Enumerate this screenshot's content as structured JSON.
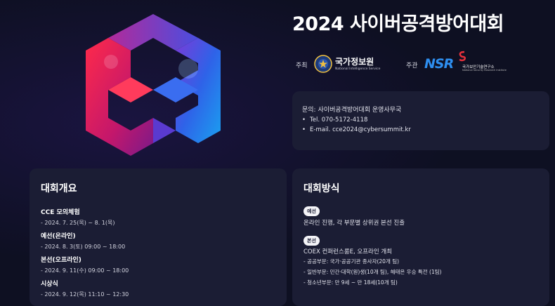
{
  "hero": {
    "title": "2024 사이버공격방어대회",
    "host_label": "주최",
    "host_name": "국가정보원",
    "host_en": "National Intelligence Service",
    "organizer_label": "주관",
    "organizer_logo": "NSR",
    "organizer_name": "국가보안기술연구소",
    "organizer_en": "National Security Research Institute"
  },
  "contact": {
    "title": "문의: 사이버공격방어대회 운영사무국",
    "tel": "Tel. 070-5172-4118",
    "email": "E-mail. cce2024@cybersummit.kr"
  },
  "overview": {
    "title": "대회개요",
    "items": [
      {
        "heading": "CCE 모의체험",
        "detail": "- 2024. 7. 25(목) ~ 8. 1(목)"
      },
      {
        "heading": "예선(온라인)",
        "detail": "- 2024. 8. 3(토) 09:00 ~ 18:00"
      },
      {
        "heading": "본선(오프라인)",
        "detail": "- 2024. 9. 11(수) 09:00 ~ 18:00"
      },
      {
        "heading": "시상식",
        "detail": "- 2024. 9. 12(목) 11:10 ~ 12:30"
      }
    ]
  },
  "method": {
    "title": "대회방식",
    "prelim_badge": "예선",
    "prelim_text": "온라인 진행, 각 부문별 상위권 본선 진출",
    "final_badge": "본선",
    "final_text": "COEX 컨퍼런스룸E, 오프라인 개최",
    "divisions": [
      "- 공공부문: 국가·공공기관 종사자(20개 팀)",
      "- 일반부문: 민간·대학(원)생(10개 팀), 해태은 우승 특전 (1팀)",
      "- 청소년부문: 만 9세 ~ 만 18세(10개 팀)"
    ]
  }
}
